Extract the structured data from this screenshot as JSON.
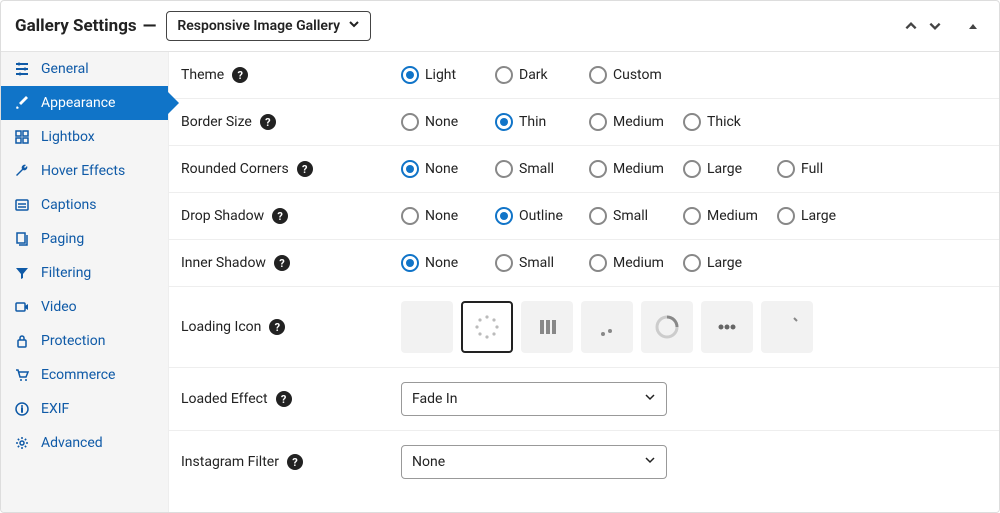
{
  "header": {
    "title": "Gallery Settings",
    "dropdown_selected": "Responsive Image Gallery"
  },
  "sidebar": {
    "items": [
      {
        "label": "General"
      },
      {
        "label": "Appearance"
      },
      {
        "label": "Lightbox"
      },
      {
        "label": "Hover Effects"
      },
      {
        "label": "Captions"
      },
      {
        "label": "Paging"
      },
      {
        "label": "Filtering"
      },
      {
        "label": "Video"
      },
      {
        "label": "Protection"
      },
      {
        "label": "Ecommerce"
      },
      {
        "label": "EXIF"
      },
      {
        "label": "Advanced"
      }
    ]
  },
  "rows": {
    "theme_label": "Theme",
    "theme_options": [
      "Light",
      "Dark",
      "Custom"
    ],
    "theme_selected": "Light",
    "border_label": "Border Size",
    "border_options": [
      "None",
      "Thin",
      "Medium",
      "Thick"
    ],
    "border_selected": "Thin",
    "corners_label": "Rounded Corners",
    "corners_options": [
      "None",
      "Small",
      "Medium",
      "Large",
      "Full"
    ],
    "corners_selected": "None",
    "dropshadow_label": "Drop Shadow",
    "dropshadow_options": [
      "None",
      "Outline",
      "Small",
      "Medium",
      "Large"
    ],
    "dropshadow_selected": "Outline",
    "innershadow_label": "Inner Shadow",
    "innershadow_options": [
      "None",
      "Small",
      "Medium",
      "Large"
    ],
    "innershadow_selected": "None",
    "loading_label": "Loading Icon",
    "loading_selected_index": 1,
    "loaded_effect_label": "Loaded Effect",
    "loaded_effect_selected": "Fade In",
    "instagram_label": "Instagram Filter",
    "instagram_selected": "None"
  }
}
